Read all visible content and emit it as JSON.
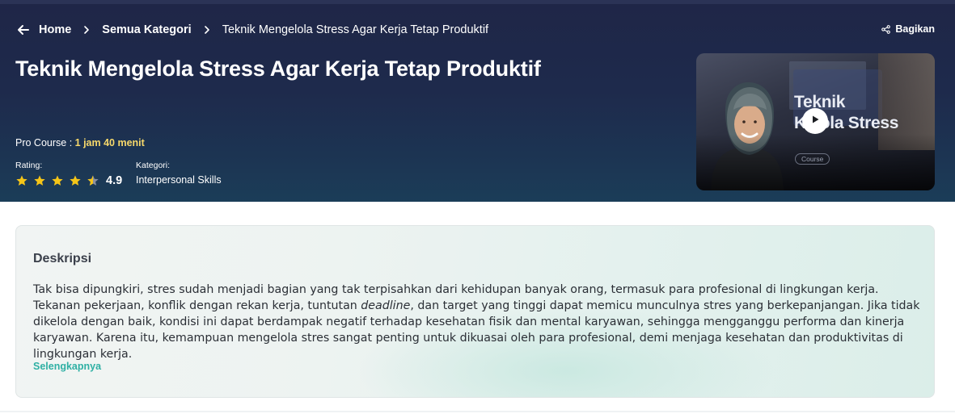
{
  "breadcrumb": {
    "home": "Home",
    "categories": "Semua Kategori",
    "current": "Teknik Mengelola Stress Agar Kerja Tetap Produktif"
  },
  "share_label": "Bagikan",
  "course": {
    "title": "Teknik Mengelola Stress Agar Kerja Tetap Produktif",
    "duration_label": "Pro Course : ",
    "duration_value": "1 jam 40 menit",
    "rating_label": "Rating:",
    "rating_value": "4.9",
    "rating_stars": 4.5,
    "category_label": "Kategori:",
    "category_value": "Interpersonal Skills"
  },
  "thumbnail": {
    "line1": "Teknik",
    "line2": "Kelola Stress",
    "badge": "Course",
    "icon": "play-icon"
  },
  "description": {
    "title": "Deskripsi",
    "text_before": "Tak bisa dipungkiri, stres sudah menjadi bagian yang tak terpisahkan dari kehidupan banyak orang, termasuk para profesional di lingkungan kerja. Tekanan pekerjaan, konflik dengan rekan kerja, tuntutan ",
    "text_em": "deadline",
    "text_after": ", dan target yang tinggi dapat memicu munculnya stres yang berkepanjangan. Jika tidak dikelola dengan baik, kondisi ini dapat berdampak negatif terhadap kesehatan fisik dan mental karyawan, sehingga mengganggu performa dan kinerja karyawan. Karena itu, kemampuan mengelola stres sangat penting untuk dikuasai oleh para profesional, demi menjaga kesehatan dan produktivitas di lingkungan kerja.",
    "more_label": "Selengkapnya"
  },
  "colors": {
    "hero_bg": "#1f2647",
    "accent_duration": "#f6d86b",
    "star": "#f5c518",
    "link": "#2fb0a4"
  }
}
